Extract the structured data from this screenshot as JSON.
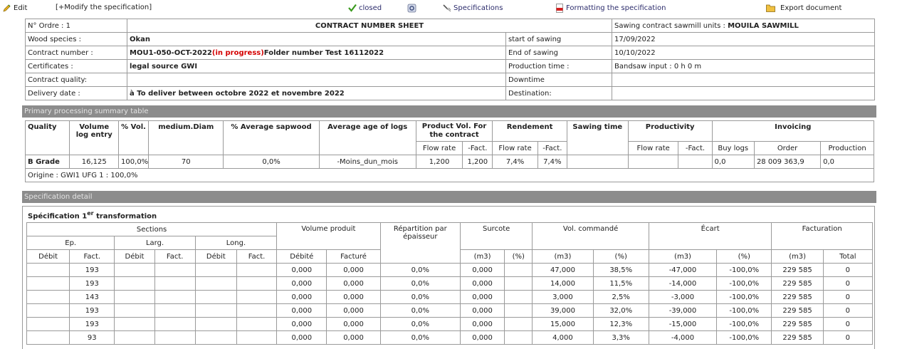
{
  "toolbar": {
    "edit": "Edit",
    "modify": "[+Modify the specification]",
    "closed": "closed",
    "specifications": "Specifications",
    "formatting": "Formatting the specification",
    "export": "Export document"
  },
  "header": {
    "order": "N° Ordre : 1",
    "title": "CONTRACT NUMBER SHEET",
    "units_label": "Sawing contract sawmill units : ",
    "units_value": "MOUILA SAWMILL",
    "rows": [
      {
        "label": "Wood species :",
        "value": "Okan",
        "label2": "start of sawing",
        "value2": "17/09/2022"
      },
      {
        "label": "Contract number :",
        "value": "MOU1-050-OCT-2022",
        "status": "(in progress)",
        "value_tail": "Folder number Test 16112022",
        "label2": "End of sawing",
        "value2": "10/10/2022"
      },
      {
        "label": "Certificates :",
        "value": "legal source GWI",
        "label2": "Production time :",
        "value2": "Bandsaw input : 0 h 0 m"
      },
      {
        "label": "Contract quality:",
        "value": "",
        "label2": "Downtime",
        "value2": ""
      },
      {
        "label": "Delivery date :",
        "value": "à To deliver between octobre 2022 et novembre 2022",
        "label2": "Destination:",
        "value2": ""
      }
    ]
  },
  "summary": {
    "section_title": "Primary processing summary table",
    "headers": {
      "quality": "Quality",
      "volume": "Volume log entry",
      "pct_vol": "% Vol.",
      "diam": "medium.Diam",
      "sapwood": "% Average sapwood",
      "age": "Average age of logs",
      "product_vol": "Product Vol. For the contract",
      "rendement": "Rendement",
      "sawing_time": "Sawing time",
      "productivity": "Productivity",
      "invoicing": "Invoicing",
      "flow_rate": "Flow rate",
      "fact": "-Fact.",
      "buy_logs": "Buy logs",
      "order": "Order",
      "production": "Production"
    },
    "row": {
      "quality": "B Grade",
      "volume": "16,125",
      "pct_vol": "100,0%",
      "diam": "70",
      "sapwood": "0,0%",
      "age": "-Moins_dun_mois",
      "pv_flow": "1,200",
      "pv_fact": "1,200",
      "rd_flow": "7,4%",
      "rd_fact": "7,4%",
      "sawing_time": "",
      "pr_flow": "",
      "pr_fact": "",
      "buy_logs": "0,0",
      "order": "28 009 363,9",
      "production": "0,0"
    },
    "origin": "Origine : GWI1 UFG 1 : 100,0%"
  },
  "detail": {
    "section_title": "Specification detail",
    "spec_title_pre": "Spécification 1",
    "spec_title_sup": "er",
    "spec_title_post": " transformation",
    "headers": {
      "sections": "Sections",
      "volume_produit": "Volume produit",
      "repartition": "Répartition par épaisseur",
      "surcote": "Surcote",
      "vol_commande": "Vol. commandé",
      "ecart": "Écart",
      "facturation": "Facturation",
      "ep": "Ep.",
      "larg": "Larg.",
      "long": "Long.",
      "debit": "Débit",
      "fact": "Fact.",
      "debite": "Débité",
      "facture": "Facturé",
      "m3": "(m3)",
      "pct": "(%)",
      "total": "Total"
    },
    "rows": [
      {
        "ep_fact": "193",
        "vol_deb": "0,000",
        "vol_fac": "0,000",
        "rep": "0,0%",
        "sur_m3": "0,000",
        "sur_pct": "",
        "cmd_m3": "47,000",
        "cmd_pct": "38,5%",
        "ec_m3": "-47,000",
        "ec_pct": "-100,0%",
        "fac_m3": "229 585",
        "total": "0"
      },
      {
        "ep_fact": "193",
        "vol_deb": "0,000",
        "vol_fac": "0,000",
        "rep": "0,0%",
        "sur_m3": "0,000",
        "sur_pct": "",
        "cmd_m3": "14,000",
        "cmd_pct": "11,5%",
        "ec_m3": "-14,000",
        "ec_pct": "-100,0%",
        "fac_m3": "229 585",
        "total": "0"
      },
      {
        "ep_fact": "143",
        "vol_deb": "0,000",
        "vol_fac": "0,000",
        "rep": "0,0%",
        "sur_m3": "0,000",
        "sur_pct": "",
        "cmd_m3": "3,000",
        "cmd_pct": "2,5%",
        "ec_m3": "-3,000",
        "ec_pct": "-100,0%",
        "fac_m3": "229 585",
        "total": "0"
      },
      {
        "ep_fact": "193",
        "vol_deb": "0,000",
        "vol_fac": "0,000",
        "rep": "0,0%",
        "sur_m3": "0,000",
        "sur_pct": "",
        "cmd_m3": "39,000",
        "cmd_pct": "32,0%",
        "ec_m3": "-39,000",
        "ec_pct": "-100,0%",
        "fac_m3": "229 585",
        "total": "0"
      },
      {
        "ep_fact": "193",
        "vol_deb": "0,000",
        "vol_fac": "0,000",
        "rep": "0,0%",
        "sur_m3": "0,000",
        "sur_pct": "",
        "cmd_m3": "15,000",
        "cmd_pct": "12,3%",
        "ec_m3": "-15,000",
        "ec_pct": "-100,0%",
        "fac_m3": "229 585",
        "total": "0"
      },
      {
        "ep_fact": "93",
        "vol_deb": "0,000",
        "vol_fac": "0,000",
        "rep": "0,0%",
        "sur_m3": "0,000",
        "sur_pct": "",
        "cmd_m3": "4,000",
        "cmd_pct": "3,3%",
        "ec_m3": "-4,000",
        "ec_pct": "-100,0%",
        "fac_m3": "229 585",
        "total": "0"
      }
    ]
  },
  "colors": {
    "section_bar": "#8c8c8c",
    "status_red": "#d40000",
    "check_green": "#3a9a1e",
    "link_blue": "#2b2b6b"
  }
}
